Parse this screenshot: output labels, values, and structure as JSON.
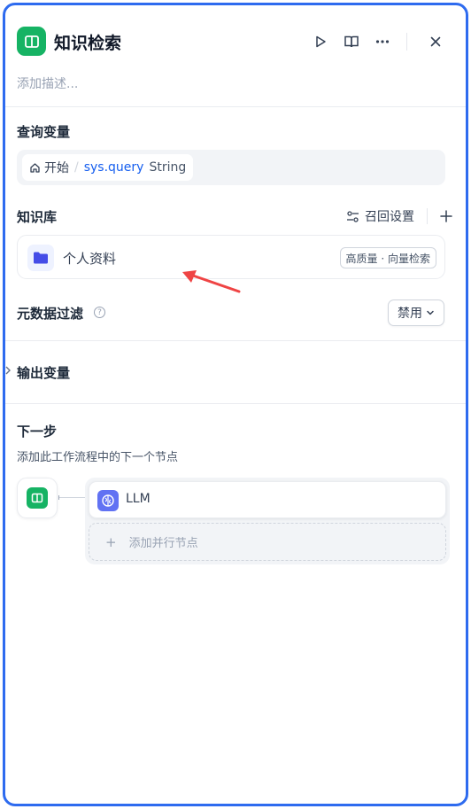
{
  "header": {
    "title": "知识检索",
    "description_placeholder": "添加描述..."
  },
  "query": {
    "section_title": "查询变量",
    "source": "开始",
    "separator": "/",
    "variable": "sys.query",
    "type": "String"
  },
  "knowledge": {
    "section_title": "知识库",
    "recall_settings_label": "召回设置",
    "items": [
      {
        "name": "个人资料",
        "badge": "高质量 · 向量检索"
      }
    ]
  },
  "metadata_filter": {
    "title": "元数据过滤",
    "help": "?",
    "value": "禁用"
  },
  "output": {
    "title": "输出变量"
  },
  "next_step": {
    "title": "下一步",
    "subtitle": "添加此工作流程中的下一个节点",
    "nodes": [
      {
        "label": "LLM"
      }
    ],
    "add_parallel_label": "添加并行节点"
  },
  "colors": {
    "frame_border": "#2e6bef",
    "node_green": "#16b364",
    "llm_indigo": "#6172f3",
    "variable_blue": "#155eef",
    "annotation_arrow": "#ef4444"
  },
  "icons": [
    "book-icon",
    "play-icon",
    "book-open-icon",
    "more-icon",
    "close-icon",
    "home-icon",
    "settings-sliders-icon",
    "plus-icon",
    "folder-icon",
    "help-icon",
    "chevron-down-icon",
    "chevron-right-icon",
    "brain-icon"
  ]
}
